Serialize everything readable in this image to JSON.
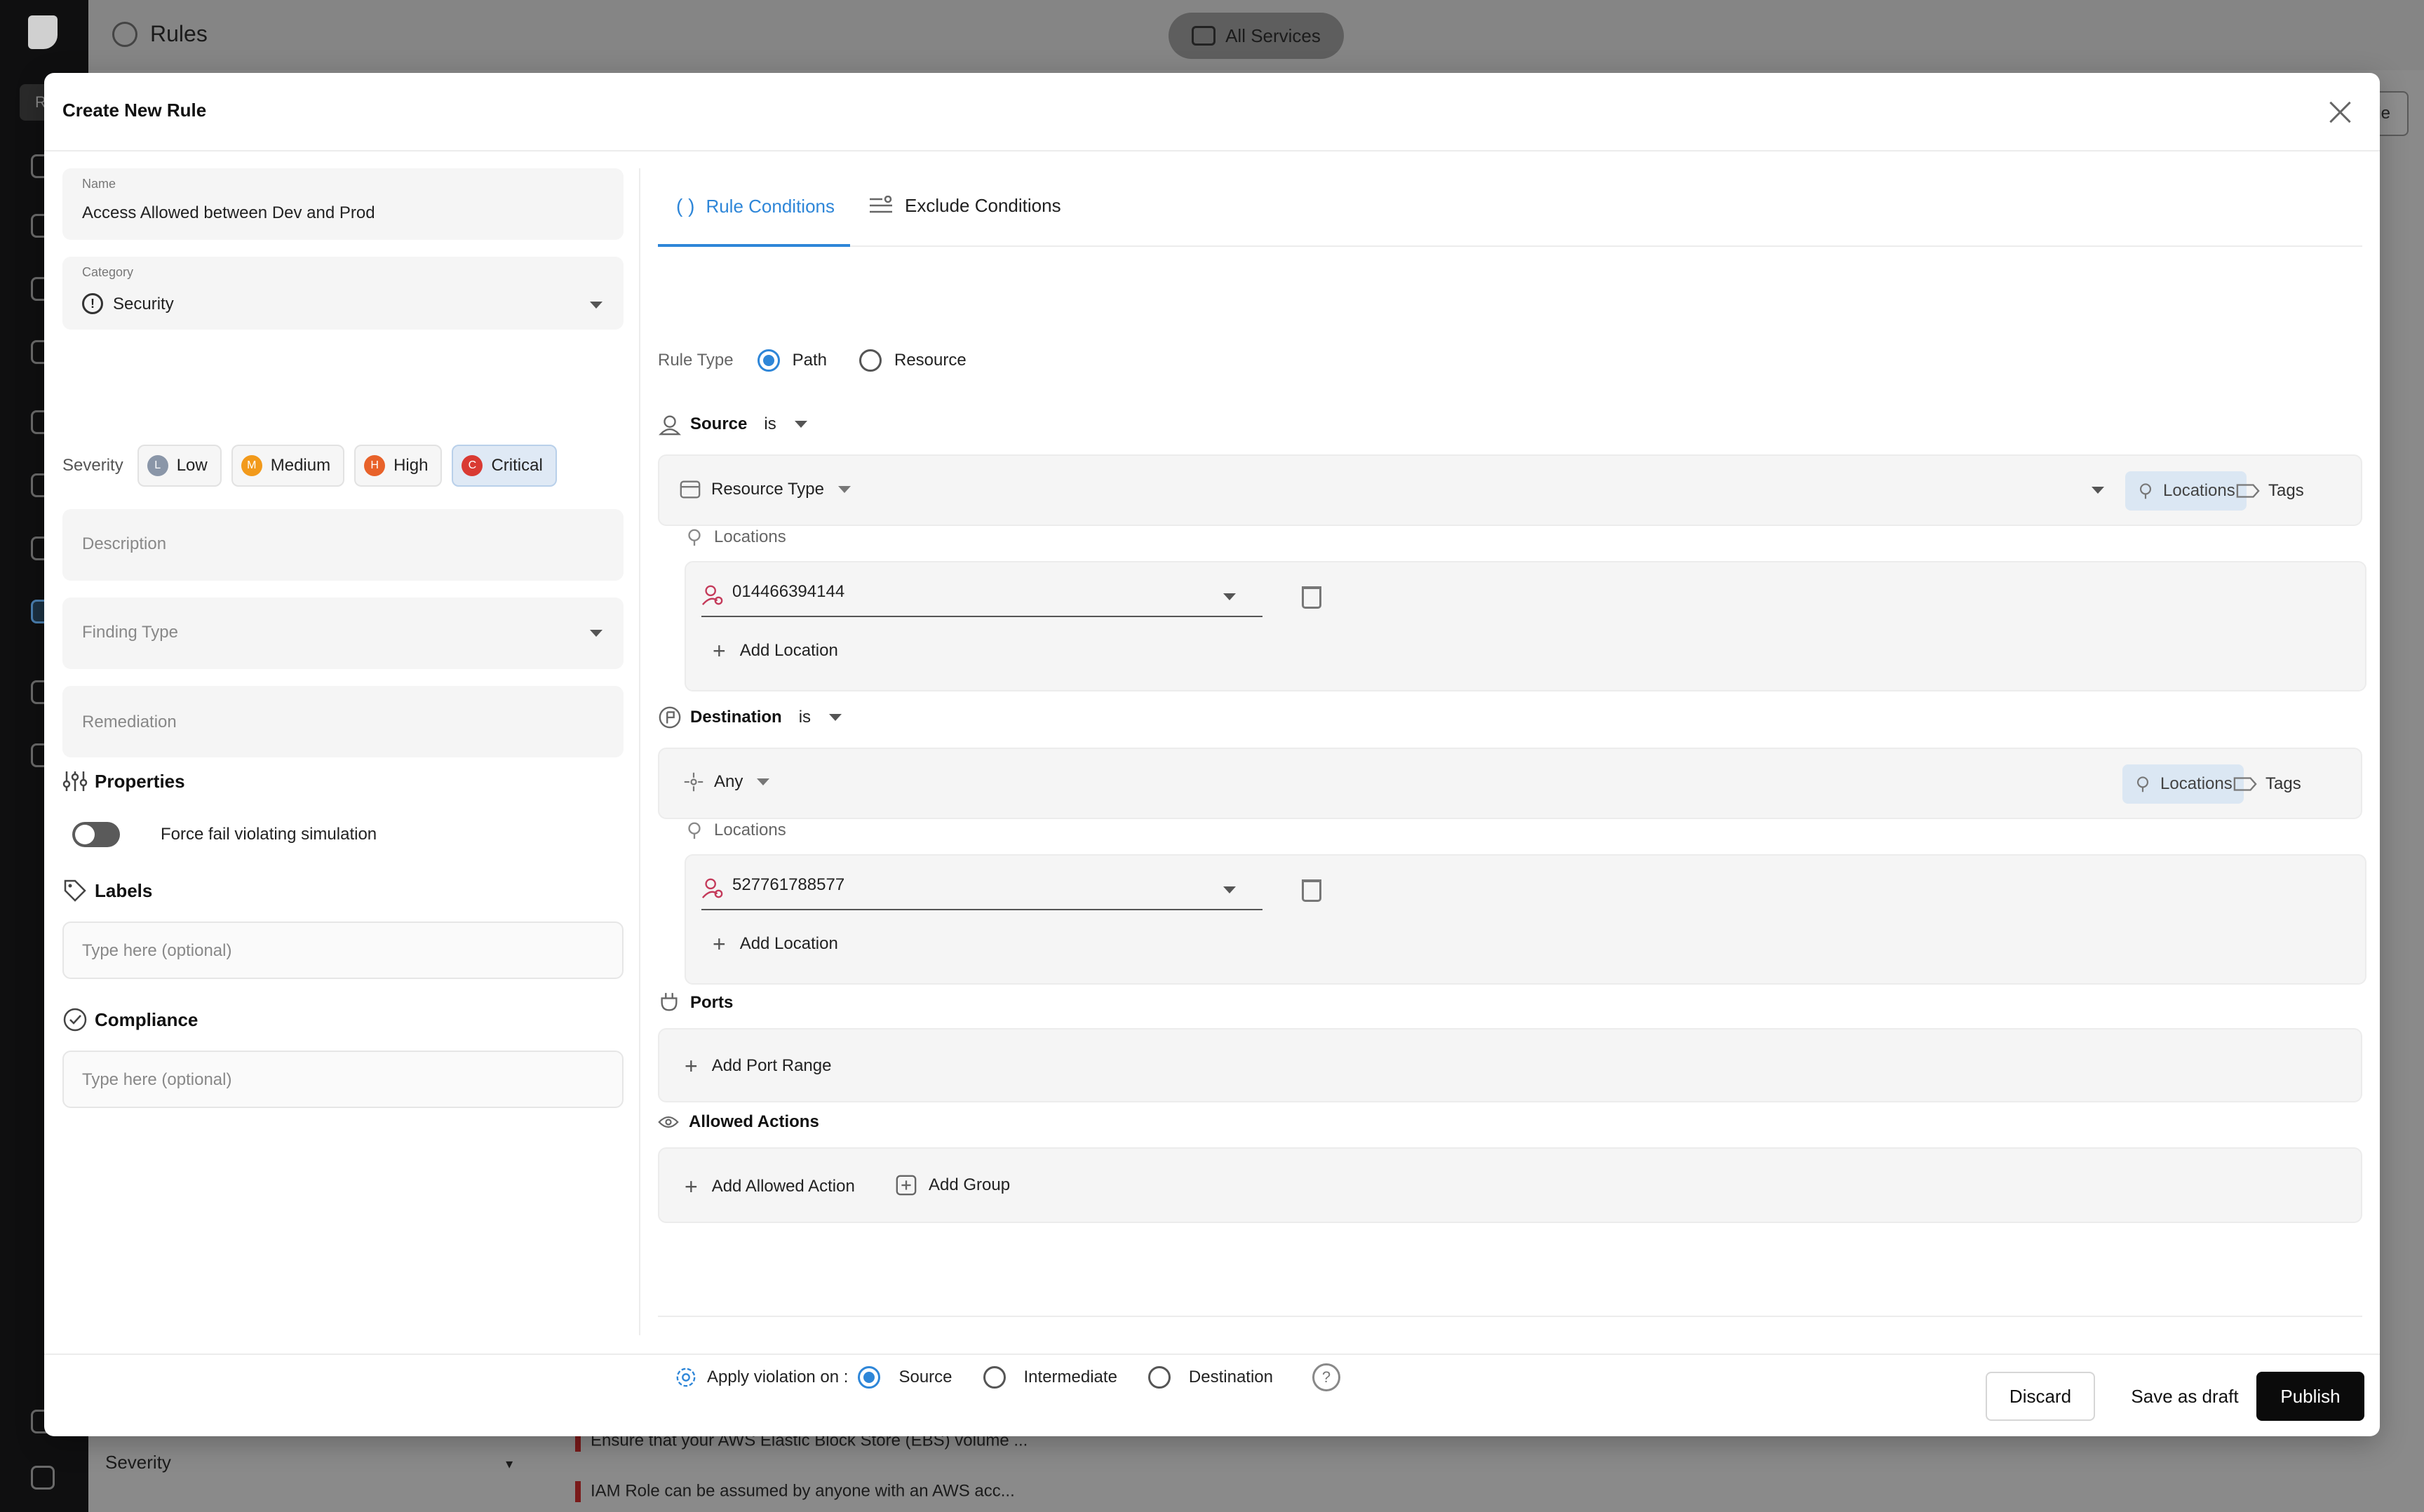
{
  "background": {
    "page_title": "Rules",
    "services_button": "All Services",
    "right_button_fragment": "ule",
    "left_fragment": "R",
    "severity_filter": "Severity",
    "rows": [
      "Ensure that your AWS Elastic Block Store (EBS) volume ...",
      "IAM Role can be assumed by anyone with an AWS acc..."
    ]
  },
  "modal": {
    "title": "Create New Rule",
    "name": {
      "label": "Name",
      "value": "Access Allowed between Dev and Prod"
    },
    "category": {
      "label": "Category",
      "value": "Security"
    },
    "severity": {
      "label": "Severity",
      "options": [
        {
          "letter": "L",
          "label": "Low",
          "color": "#8a96a8"
        },
        {
          "letter": "M",
          "label": "Medium",
          "color": "#f29a1b"
        },
        {
          "letter": "H",
          "label": "High",
          "color": "#e8622a"
        },
        {
          "letter": "C",
          "label": "Critical",
          "color": "#d93a33"
        }
      ],
      "selected": "Critical"
    },
    "description_placeholder": "Description",
    "finding_type_placeholder": "Finding Type",
    "remediation_placeholder": "Remediation",
    "properties_title": "Properties",
    "force_fail_label": "Force fail violating simulation",
    "labels_title": "Labels",
    "labels_placeholder": "Type here (optional)",
    "compliance_title": "Compliance",
    "compliance_placeholder": "Type here (optional)",
    "tabs": [
      {
        "label": "Rule Conditions",
        "active": true
      },
      {
        "label": "Exclude Conditions",
        "active": false
      }
    ],
    "rule_type": {
      "label": "Rule Type",
      "options": [
        "Path",
        "Resource"
      ],
      "selected": "Path"
    },
    "source": {
      "title": "Source",
      "operator": "is",
      "selector": "Resource Type",
      "locations_pill": "Locations",
      "tags_pill": "Tags",
      "locations_label": "Locations",
      "location_value": "014466394144",
      "add_location": "Add Location"
    },
    "destination": {
      "title": "Destination",
      "operator": "is",
      "selector": "Any",
      "locations_pill": "Locations",
      "tags_pill": "Tags",
      "locations_label": "Locations",
      "location_value": "527761788577",
      "add_location": "Add Location"
    },
    "ports": {
      "title": "Ports",
      "add_label": "Add Port Range"
    },
    "allowed_actions": {
      "title": "Allowed Actions",
      "add_action": "Add Allowed Action",
      "add_group": "Add Group"
    },
    "apply_violation": {
      "label": "Apply violation on :",
      "options": [
        "Source",
        "Intermediate",
        "Destination"
      ],
      "selected": "Source",
      "help": "?"
    },
    "footer": {
      "discard": "Discard",
      "save_draft": "Save as draft",
      "publish": "Publish"
    }
  },
  "colors": {
    "accent": "#2e86d8",
    "primary_button": "#0b0b0b"
  }
}
